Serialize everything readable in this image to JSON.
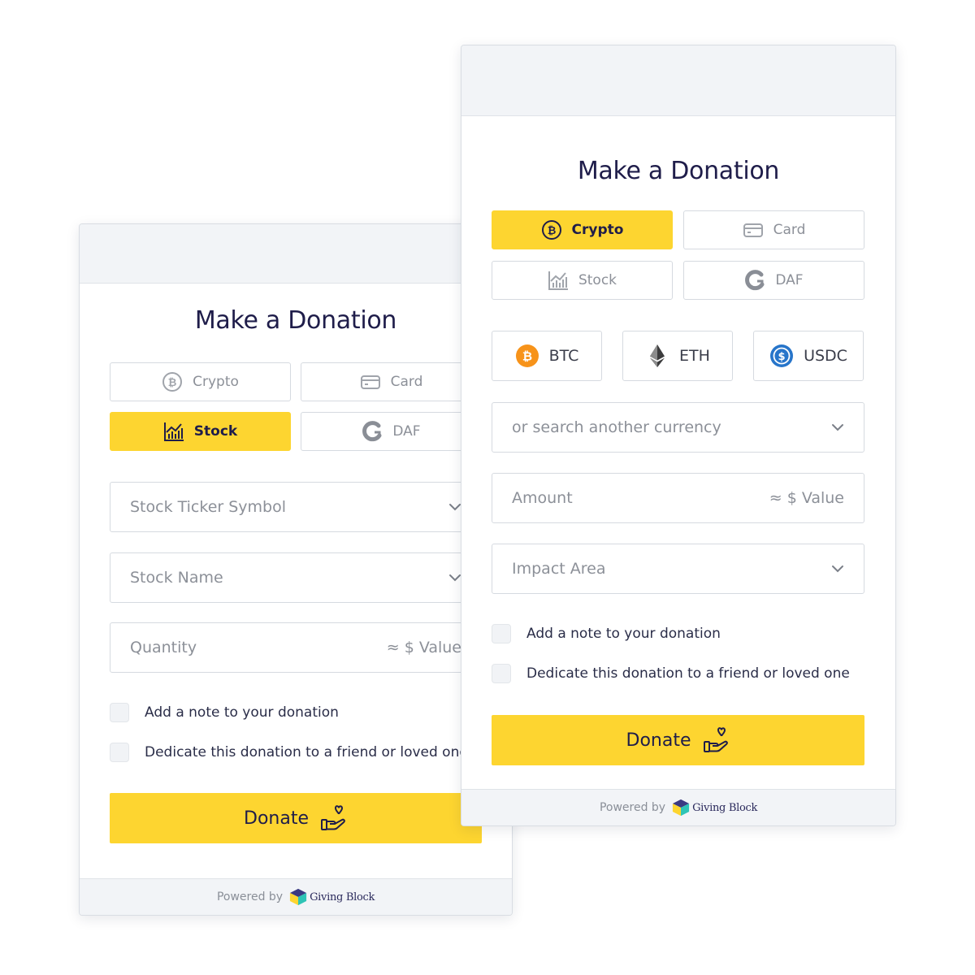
{
  "colors": {
    "accent": "#fdd530",
    "title": "#1f1d4a",
    "placeholder": "#8c9098",
    "btc": "#f7931a",
    "usdc": "#2775ca"
  },
  "stock_widget": {
    "title": "Make a Donation",
    "tabs": [
      {
        "label": "Crypto",
        "icon": "bitcoin-icon",
        "active": false
      },
      {
        "label": "Card",
        "icon": "credit-card-icon",
        "active": false
      },
      {
        "label": "Stock",
        "icon": "stock-chart-icon",
        "active": true
      },
      {
        "label": "DAF",
        "icon": "daf-logo-icon",
        "active": false
      }
    ],
    "ticker_placeholder": "Stock Ticker Symbol",
    "name_placeholder": "Stock Name",
    "quantity_placeholder": "Quantity",
    "value_suffix": "≈ $ Value",
    "note_label": "Add a note to your donation",
    "dedicate_label": "Dedicate this donation to a friend or loved one",
    "donate_label": "Donate",
    "powered_by": "Powered by",
    "brand": "Giving Block"
  },
  "crypto_widget": {
    "title": "Make a Donation",
    "tabs": [
      {
        "label": "Crypto",
        "icon": "bitcoin-icon",
        "active": true
      },
      {
        "label": "Card",
        "icon": "credit-card-icon",
        "active": false
      },
      {
        "label": "Stock",
        "icon": "stock-chart-icon",
        "active": false
      },
      {
        "label": "DAF",
        "icon": "daf-logo-icon",
        "active": false
      }
    ],
    "coins": [
      {
        "label": "BTC",
        "icon": "btc-coin-icon"
      },
      {
        "label": "ETH",
        "icon": "eth-coin-icon"
      },
      {
        "label": "USDC",
        "icon": "usdc-coin-icon"
      }
    ],
    "search_placeholder": "or search another currency",
    "amount_placeholder": "Amount",
    "value_suffix": "≈ $ Value",
    "impact_placeholder": "Impact Area",
    "note_label": "Add a note to your donation",
    "dedicate_label": "Dedicate this donation to a friend or loved one",
    "donate_label": "Donate",
    "powered_by": "Powered by",
    "brand": "Giving Block"
  }
}
